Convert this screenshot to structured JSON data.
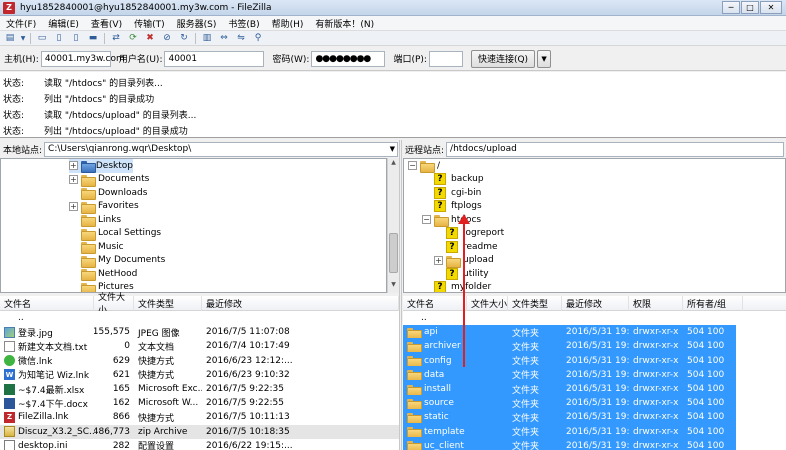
{
  "window": {
    "title": "hyu1852840001@hyu1852840001.my3w.com - FileZilla",
    "app_icon": "Z",
    "minimize": "─",
    "maximize": "□",
    "close": "✕"
  },
  "menu": [
    "文件(F)",
    "编辑(E)",
    "查看(V)",
    "传输(T)",
    "服务器(S)",
    "书签(B)",
    "帮助(H)",
    "有新版本！(N)"
  ],
  "quickconnect": {
    "host_label": "主机(H):",
    "host_value": "40001.my3w.com",
    "user_label": "用户名(U):",
    "user_value": "40001",
    "pass_label": "密码(W):",
    "pass_value": "●●●●●●●●",
    "port_label": "端口(P):",
    "port_value": "",
    "connect_label": "快速连接(Q)",
    "dropdown": "▼"
  },
  "log": [
    {
      "type": "状态:",
      "msg": "读取 \"/htdocs\" 的目录列表..."
    },
    {
      "type": "状态:",
      "msg": "列出 \"/htdocs\" 的目录成功"
    },
    {
      "type": "状态:",
      "msg": "读取 \"/htdocs/upload\" 的目录列表..."
    },
    {
      "type": "状态:",
      "msg": "列出 \"/htdocs/upload\" 的目录成功"
    }
  ],
  "local": {
    "site_label": "本地站点:",
    "path": "C:\\Users\\qianrong.wqr\\Desktop\\",
    "arrow": "▼",
    "tree": [
      {
        "label": "Desktop",
        "exp": "+",
        "icon": "blue",
        "selected": true
      },
      {
        "label": "Documents",
        "exp": "+",
        "icon": "folder"
      },
      {
        "label": "Downloads",
        "exp": "",
        "icon": "folder"
      },
      {
        "label": "Favorites",
        "exp": "+",
        "icon": "folder"
      },
      {
        "label": "Links",
        "exp": "",
        "icon": "folder"
      },
      {
        "label": "Local Settings",
        "exp": "",
        "icon": "folder"
      },
      {
        "label": "Music",
        "exp": "",
        "icon": "folder"
      },
      {
        "label": "My Documents",
        "exp": "",
        "icon": "folder"
      },
      {
        "label": "NetHood",
        "exp": "",
        "icon": "folder"
      },
      {
        "label": "Pictures",
        "exp": "",
        "icon": "folder"
      }
    ],
    "headers": [
      "文件名",
      "文件大小",
      "文件类型",
      "最近修改"
    ],
    "files": [
      {
        "name": "..",
        "size": "",
        "type": "",
        "modified": "",
        "icon": "up"
      },
      {
        "name": "登录.jpg",
        "size": "155,575",
        "type": "JPEG 图像",
        "modified": "2016/7/5 11:07:08",
        "icon": "img"
      },
      {
        "name": "新建文本文档.txt",
        "size": "0",
        "type": "文本文档",
        "modified": "2016/7/4 10:17:49",
        "icon": "txt"
      },
      {
        "name": "微信.lnk",
        "size": "629",
        "type": "快捷方式",
        "modified": "2016/6/23 12:12:...",
        "icon": "lnk"
      },
      {
        "name": "为知笔记 Wiz.lnk",
        "size": "621",
        "type": "快捷方式",
        "modified": "2016/6/23 9:10:32",
        "icon": "wiz"
      },
      {
        "name": "~$7.4最新.xlsx",
        "size": "165",
        "type": "Microsoft Exc...",
        "modified": "2016/7/5 9:22:35",
        "icon": "xls"
      },
      {
        "name": "~$7.4下午.docx",
        "size": "162",
        "type": "Microsoft W...",
        "modified": "2016/7/5 9:22:55",
        "icon": "doc"
      },
      {
        "name": "FileZilla.lnk",
        "size": "866",
        "type": "快捷方式",
        "modified": "2016/7/5 10:11:13",
        "icon": "fz"
      },
      {
        "name": "Discuz_X3.2_SC...",
        "size": "12,486,773",
        "type": "zip Archive",
        "modified": "2016/7/5 10:18:35",
        "icon": "zip",
        "selected": true
      },
      {
        "name": "desktop.ini",
        "size": "282",
        "type": "配置设置",
        "modified": "2016/6/22 19:15:...",
        "icon": "ini"
      }
    ]
  },
  "remote": {
    "site_label": "远程站点:",
    "path": "/htdocs/upload",
    "tree": [
      {
        "label": "/",
        "depth": 0,
        "exp": "−",
        "icon": "folder"
      },
      {
        "label": "backup",
        "depth": 1,
        "exp": "",
        "icon": "q"
      },
      {
        "label": "cgi-bin",
        "depth": 1,
        "exp": "",
        "icon": "q"
      },
      {
        "label": "ftplogs",
        "depth": 1,
        "exp": "",
        "icon": "q"
      },
      {
        "label": "htdocs",
        "depth": 1,
        "exp": "−",
        "icon": "folder"
      },
      {
        "label": "logreport",
        "depth": 2,
        "exp": "",
        "icon": "q"
      },
      {
        "label": "readme",
        "depth": 2,
        "exp": "",
        "icon": "q"
      },
      {
        "label": "upload",
        "depth": 2,
        "exp": "+",
        "icon": "folder"
      },
      {
        "label": "utility",
        "depth": 2,
        "exp": "",
        "icon": "q"
      },
      {
        "label": "myfolder",
        "depth": 1,
        "exp": "",
        "icon": "q"
      }
    ],
    "headers": [
      "文件名",
      "文件大小",
      "文件类型",
      "最近修改",
      "权限",
      "所有者/组"
    ],
    "files": [
      {
        "name": "..",
        "type": "",
        "modified": "",
        "perm": "",
        "owner": "",
        "selected": false,
        "icon": "up"
      },
      {
        "name": "api",
        "type": "文件夹",
        "modified": "2016/5/31 19:...",
        "perm": "drwxr-xr-x",
        "owner": "504 100",
        "selected": true
      },
      {
        "name": "archiver",
        "type": "文件夹",
        "modified": "2016/5/31 19:...",
        "perm": "drwxr-xr-x",
        "owner": "504 100",
        "selected": true
      },
      {
        "name": "config",
        "type": "文件夹",
        "modified": "2016/5/31 19:...",
        "perm": "drwxr-xr-x",
        "owner": "504 100",
        "selected": true
      },
      {
        "name": "data",
        "type": "文件夹",
        "modified": "2016/5/31 19:...",
        "perm": "drwxr-xr-x",
        "owner": "504 100",
        "selected": true
      },
      {
        "name": "install",
        "type": "文件夹",
        "modified": "2016/5/31 19:...",
        "perm": "drwxr-xr-x",
        "owner": "504 100",
        "selected": true
      },
      {
        "name": "source",
        "type": "文件夹",
        "modified": "2016/5/31 19:...",
        "perm": "drwxr-xr-x",
        "owner": "504 100",
        "selected": true
      },
      {
        "name": "static",
        "type": "文件夹",
        "modified": "2016/5/31 19:...",
        "perm": "drwxr-xr-x",
        "owner": "504 100",
        "selected": true
      },
      {
        "name": "template",
        "type": "文件夹",
        "modified": "2016/5/31 19:...",
        "perm": "drwxr-xr-x",
        "owner": "504 100",
        "selected": true
      },
      {
        "name": "uc_client",
        "type": "文件夹",
        "modified": "2016/5/31 19:...",
        "perm": "drwxr-xr-x",
        "owner": "504 100",
        "selected": true
      }
    ]
  },
  "colors": {
    "selection": "#3399ff",
    "annotation_arrow": "#e02020",
    "folder": "#f7d67a"
  }
}
